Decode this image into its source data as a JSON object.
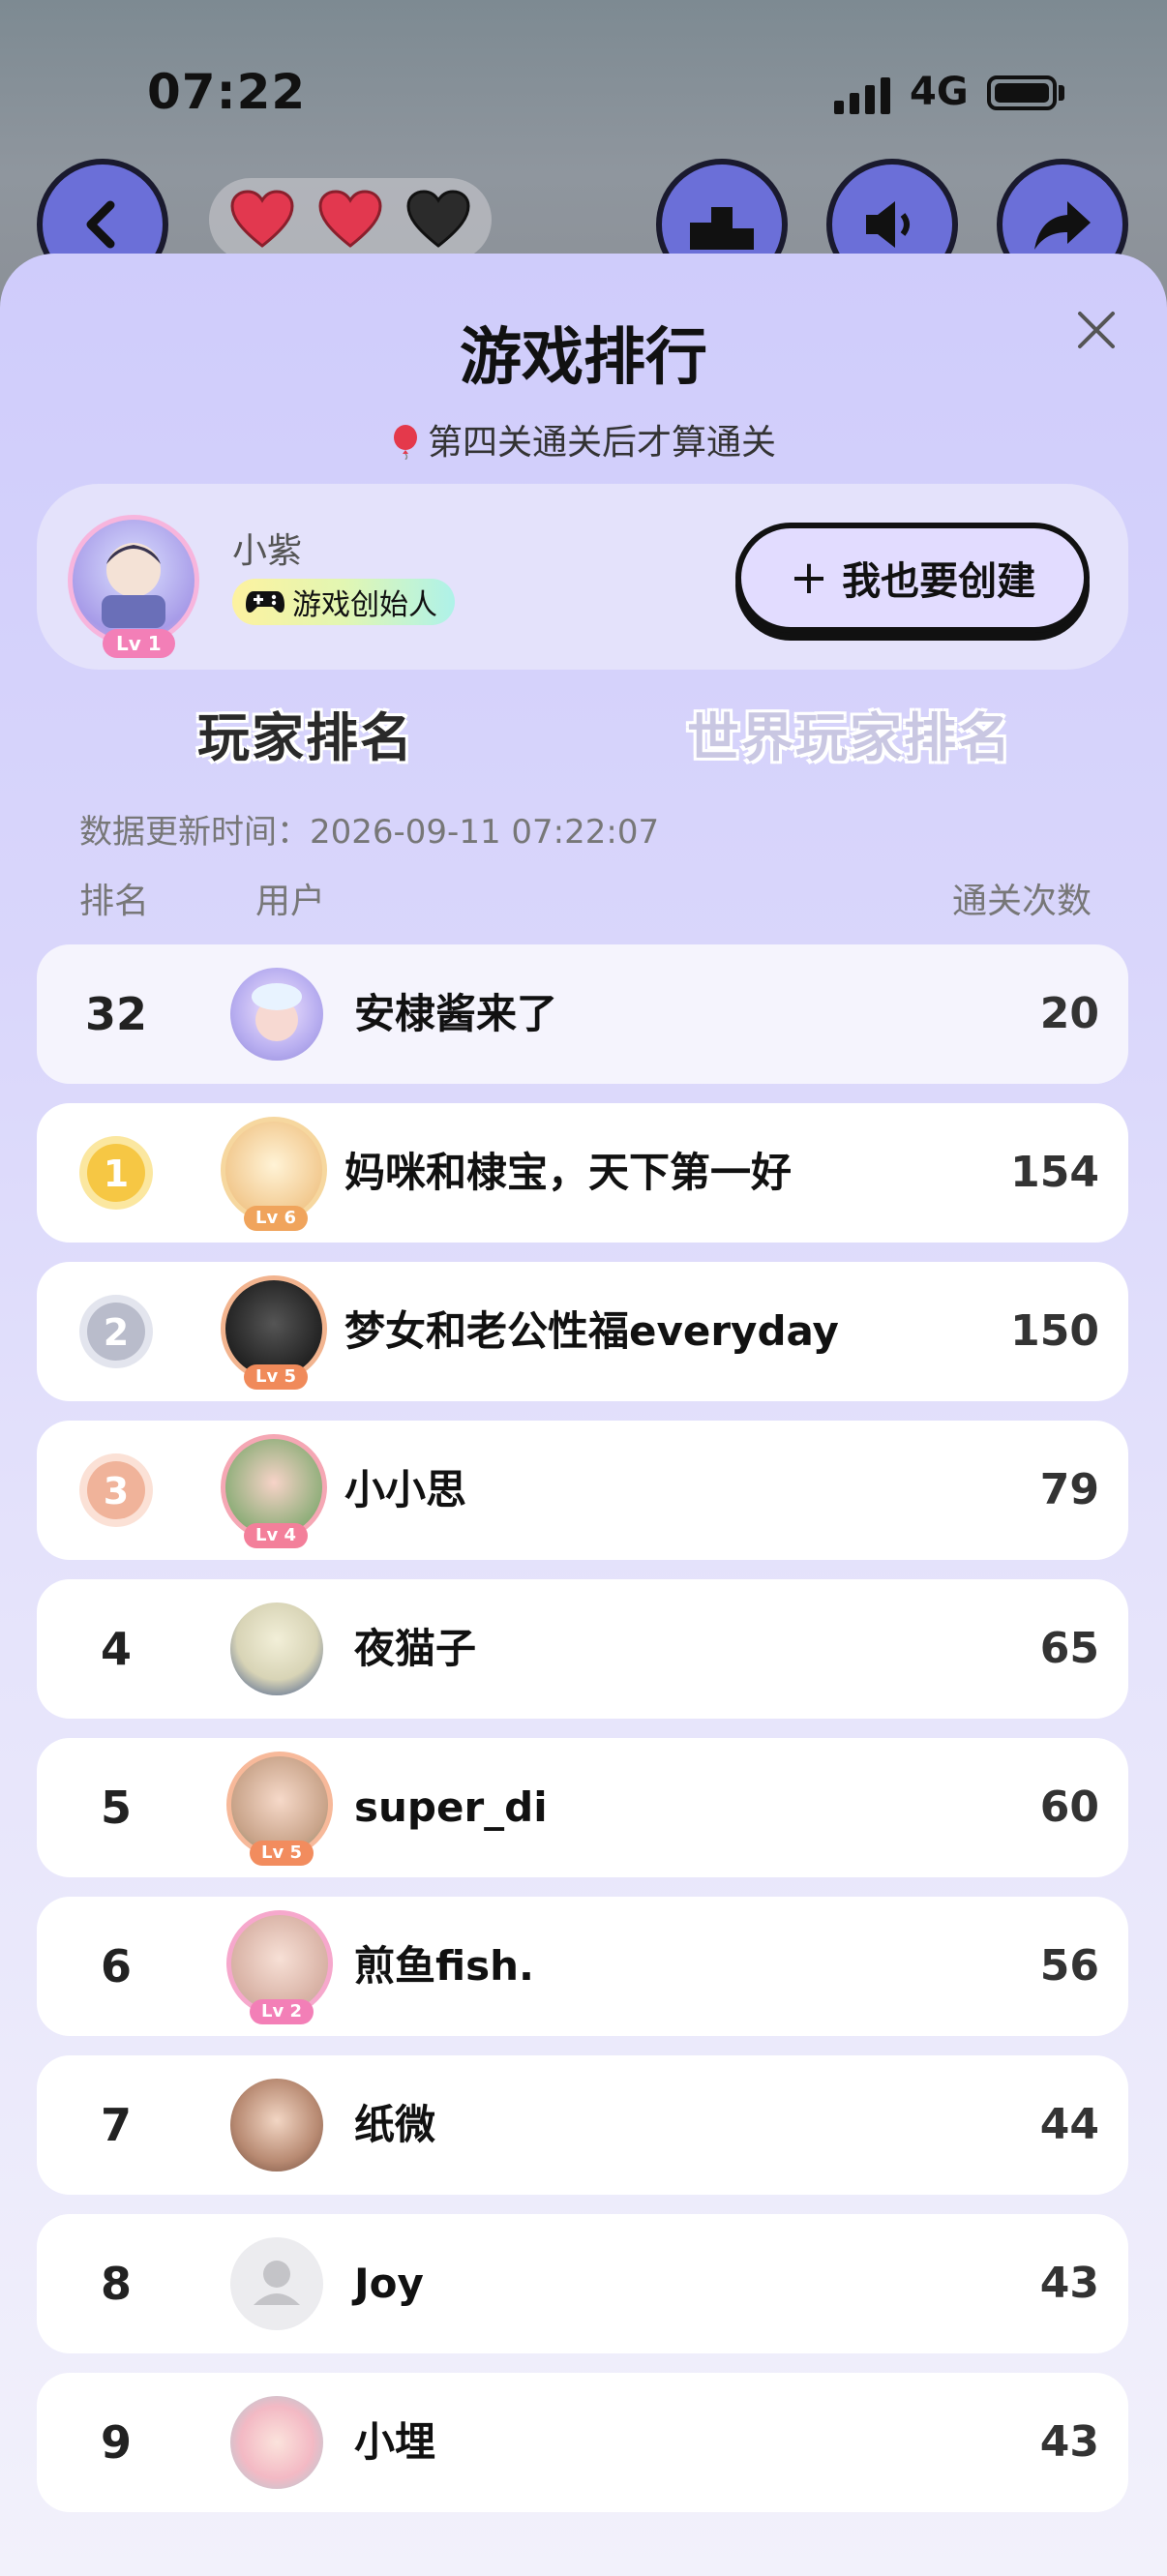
{
  "status_bar": {
    "time": "07:22",
    "network": "4G"
  },
  "game_bar": {
    "lives": [
      {
        "state": "full"
      },
      {
        "state": "full"
      },
      {
        "state": "empty"
      }
    ]
  },
  "sheet": {
    "title": "游戏排行",
    "subtitle": "第四关通关后才算通关"
  },
  "creator": {
    "name": "小紫",
    "badge": "游戏创始人",
    "level": "Lv 1",
    "create_button": "我也要创建"
  },
  "tabs": [
    {
      "label": "玩家排名",
      "active": true
    },
    {
      "label": "世界玩家排名",
      "active": false
    }
  ],
  "update_time": "数据更新时间：2026-09-11 07:22:07",
  "columns": {
    "rank": "排名",
    "user": "用户",
    "clears": "通关次数"
  },
  "my_row": {
    "rank": "32",
    "name": "安棣酱来了",
    "score": "20"
  },
  "rows": [
    {
      "rank": "1",
      "name": "妈咪和棣宝，天下第一好",
      "score": "154",
      "level": "Lv 6",
      "medal": "gold"
    },
    {
      "rank": "2",
      "name": "梦女和老公性福everyday",
      "score": "150",
      "level": "Lv 5",
      "medal": "silver"
    },
    {
      "rank": "3",
      "name": "小小思",
      "score": "79",
      "level": "Lv 4",
      "medal": "bronze"
    },
    {
      "rank": "4",
      "name": "夜猫子",
      "score": "65"
    },
    {
      "rank": "5",
      "name": "super_di",
      "score": "60",
      "level": "Lv 5"
    },
    {
      "rank": "6",
      "name": "煎鱼fish.",
      "score": "56",
      "level": "Lv 2"
    },
    {
      "rank": "7",
      "name": "纸微",
      "score": "44"
    },
    {
      "rank": "8",
      "name": "Joy",
      "score": "43"
    },
    {
      "rank": "9",
      "name": "小埋",
      "score": "43"
    }
  ],
  "colors": {
    "accent_purple": "#6b6fd8",
    "sheet_top": "#cfccfb",
    "level_badge": "#f37fb7",
    "gold": "#f6c744",
    "silver": "#b9bccb",
    "bronze": "#f0b39a"
  }
}
